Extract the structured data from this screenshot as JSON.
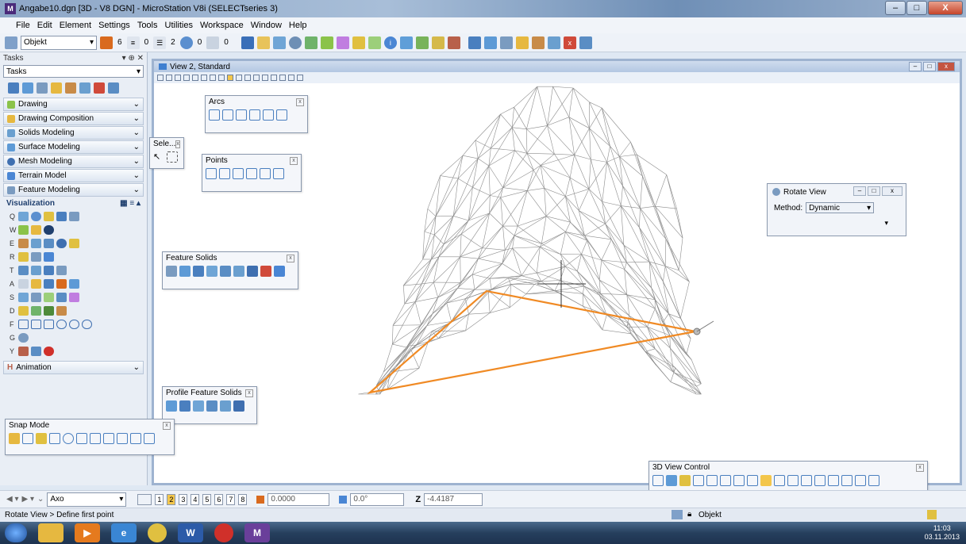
{
  "window": {
    "title": "Angabe10.dgn [3D - V8 DGN] - MicroStation V8i (SELECTseries 3)",
    "app_icon": "microstation-icon",
    "minimize": "–",
    "maximize": "□",
    "close": "X"
  },
  "menu": [
    "File",
    "Edit",
    "Element",
    "Settings",
    "Tools",
    "Utilities",
    "Workspace",
    "Window",
    "Help"
  ],
  "toolbar": {
    "level_combo": "Objekt",
    "color_value": "6",
    "style_value": "0",
    "weight_value": "2",
    "transparency_value": "0",
    "priority_value": "0"
  },
  "tasks_panel": {
    "header": "Tasks",
    "combo": "Tasks",
    "categories": [
      "Drawing",
      "Drawing Composition",
      "Solids Modeling",
      "Surface Modeling",
      "Mesh Modeling",
      "Terrain Model",
      "Feature Modeling"
    ],
    "visualization": {
      "label": "Visualization",
      "row_keys": [
        "Q",
        "W",
        "E",
        "R",
        "T",
        "A",
        "S",
        "D",
        "F",
        "G",
        "Y"
      ]
    },
    "animation": "Animation"
  },
  "view": {
    "title": "View 2, Standard"
  },
  "palettes": {
    "arcs": "Arcs",
    "select": "Sele...",
    "points": "Points",
    "feature_solids": "Feature Solids",
    "profile_feature_solids": "Profile Feature Solids",
    "snap_mode": "Snap Mode",
    "view_control": "3D View Control"
  },
  "rotate_view": {
    "title": "Rotate View",
    "method_label": "Method:",
    "method_value": "Dynamic"
  },
  "status": {
    "view_combo": "Axo",
    "page_numbers": [
      "1",
      "2",
      "3",
      "4",
      "5",
      "6",
      "7",
      "8"
    ],
    "active_page": "2",
    "field1": "0.0000",
    "field2": "0.0°",
    "z_label": "Z",
    "z_value": "-4.4187",
    "prompt": "Rotate View > Define first point",
    "level_status": "Objekt"
  },
  "taskbar": {
    "time": "11:03",
    "date": "03.11.2013"
  },
  "colors": {
    "accent": "#f08a24",
    "mesh": "#8c8c8c"
  }
}
